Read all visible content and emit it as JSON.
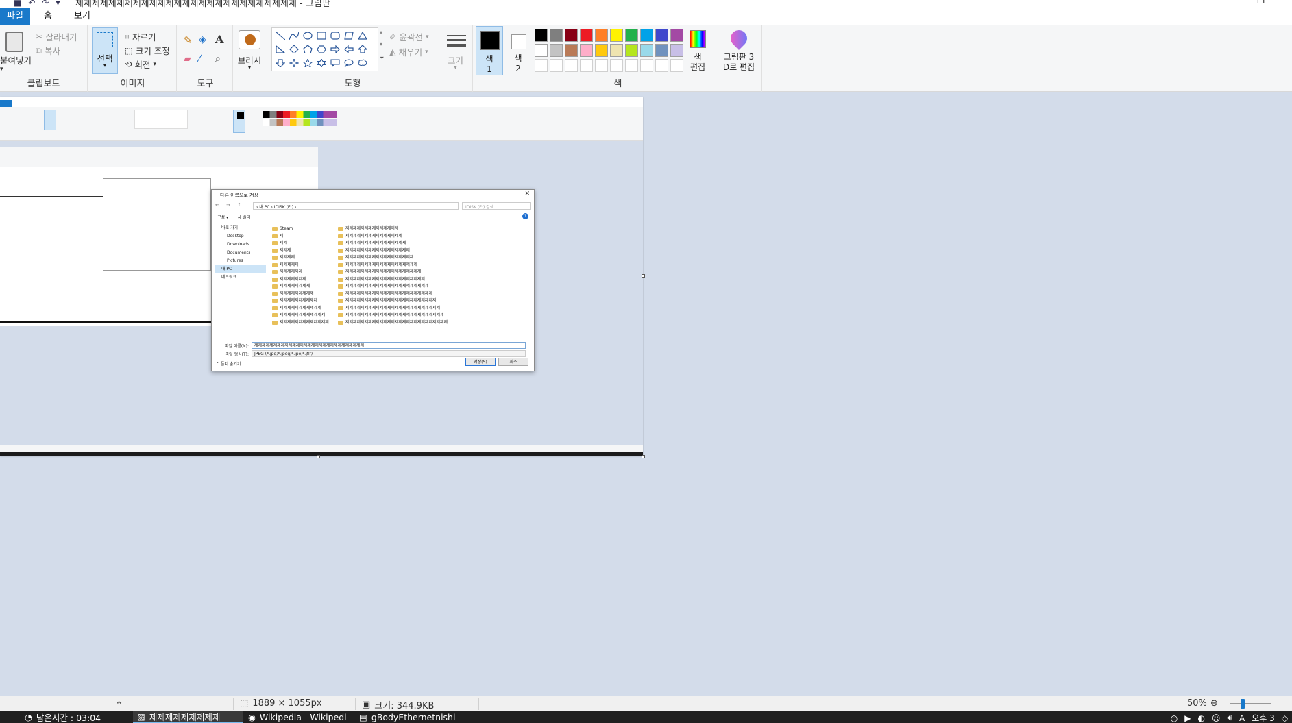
{
  "window": {
    "title": "제제제제제제제제제제제제제제제제제제제제제제제제제제제 - 그림판",
    "restore_glyph": "❐"
  },
  "menu": {
    "file": "파일",
    "home": "홈",
    "view": "보기"
  },
  "ribbon": {
    "clipboard": {
      "paste": "붙여넣기",
      "cut": "잘라내기",
      "copy": "복사",
      "label": "클립보드"
    },
    "image": {
      "select": "선택",
      "crop": "자르기",
      "resize": "크기 조정",
      "rotate": "회전",
      "label": "이미지"
    },
    "tools": {
      "label": "도구",
      "brush": "브러시"
    },
    "shapes": {
      "outline": "윤곽선",
      "fill": "채우기",
      "label": "도형"
    },
    "size": {
      "label": "크기"
    },
    "colors": {
      "color1": "색\n1",
      "color2": "색\n2",
      "edit": "색\n편집",
      "paint3d": "그림판 3\nD로 편집",
      "label": "색",
      "palette_row1": [
        "#000000",
        "#7f7f7f",
        "#880015",
        "#ed1c24",
        "#ff7f27",
        "#fff200",
        "#22b14c",
        "#00a2e8",
        "#3f48cc",
        "#a349a4"
      ],
      "palette_row2": [
        "#ffffff",
        "#c3c3c3",
        "#b97a57",
        "#ffaec9",
        "#ffc90e",
        "#efe4b0",
        "#b5e61d",
        "#99d9ea",
        "#7092be",
        "#c8bfe7"
      ]
    }
  },
  "dialog": {
    "title": "다른 이름으로 저장",
    "path": "› 내 PC › IDISK (E:) ›",
    "search_placeholder": "IDISK (E:) 검색",
    "organize": "구성 ▾",
    "new_folder": "새 폴더",
    "nav": [
      "바로 가기",
      "Desktop",
      "Downloads",
      "Documents",
      "Pictures",
      "내 PC",
      "네트워크"
    ],
    "files_col1": [
      "Steam",
      "제",
      "제제",
      "제제제",
      "제제제제",
      "제제제제제",
      "제제제제제제",
      "제제제제제제제",
      "제제제제제제제제",
      "제제제제제제제제제",
      "제제제제제제제제제제",
      "제제제제제제제제제제제",
      "제제제제제제제제제제제제",
      "제제제제제제제제제제제제제"
    ],
    "files_col2": [
      "제제제제제제제제제제제제제제",
      "제제제제제제제제제제제제제제제",
      "제제제제제제제제제제제제제제제제",
      "제제제제제제제제제제제제제제제제제",
      "제제제제제제제제제제제제제제제제제제",
      "제제제제제제제제제제제제제제제제제제제",
      "제제제제제제제제제제제제제제제제제제제제",
      "제제제제제제제제제제제제제제제제제제제제제",
      "제제제제제제제제제제제제제제제제제제제제제제",
      "제제제제제제제제제제제제제제제제제제제제제제제",
      "제제제제제제제제제제제제제제제제제제제제제제제제",
      "제제제제제제제제제제제제제제제제제제제제제제제제제",
      "제제제제제제제제제제제제제제제제제제제제제제제제제제",
      "제제제제제제제제제제제제제제제제제제제제제제제제제제제"
    ],
    "filename_label": "파일 이름(N):",
    "filename_value": "제제제제제제제제제제제제제제제제제제제제제제제제제제제제제",
    "filetype_label": "파일 형식(T):",
    "filetype_value": "JPEG (*.jpg;*.jpeg;*.jpe;*.jfif)",
    "save": "저장(S)",
    "cancel": "취소",
    "hide_folders": "^ 폴더 숨기기"
  },
  "status": {
    "dimensions": "1889 × 1055px",
    "size": "크기: 344.9KB",
    "zoom": "50%"
  },
  "taskbar": {
    "items": [
      "남은시간 : 03:04",
      "제제제제제제제제제",
      "Wikipedia - Wikipedi",
      "gBodyEthernetnishi"
    ],
    "tray": "오후 3"
  }
}
